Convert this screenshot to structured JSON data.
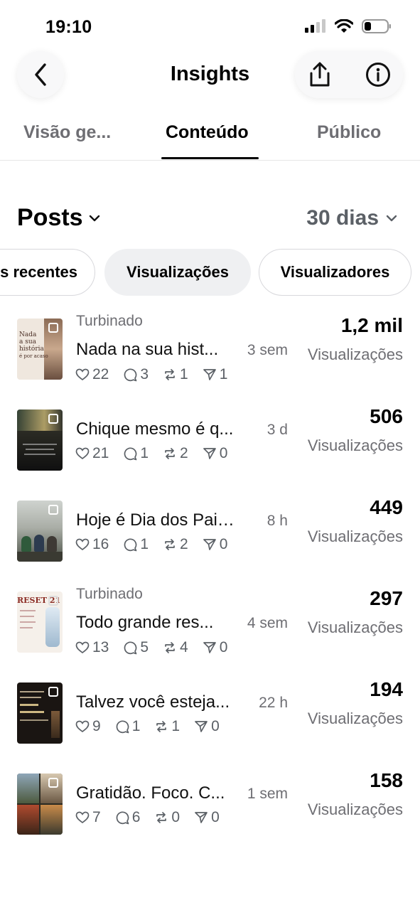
{
  "status_bar": {
    "time": "19:10"
  },
  "header": {
    "title": "Insights"
  },
  "tabs": [
    {
      "label": "Visão ge..."
    },
    {
      "label": "Conteúdo"
    },
    {
      "label": "Público"
    }
  ],
  "section": {
    "title": "Posts",
    "period": "30 dias"
  },
  "chips": [
    {
      "label": "s recentes"
    },
    {
      "label": "Visualizações"
    },
    {
      "label": "Visualizadores"
    }
  ],
  "posts": [
    {
      "promoted": "Turbinado",
      "caption": "Nada na sua hist...",
      "age": "3 sem",
      "likes": "22",
      "comments": "3",
      "reposts": "1",
      "shares": "1",
      "metric": "1,2 mil",
      "metric_label": "Visualizações",
      "thumb_text": [
        "Nada",
        "a sua",
        "história",
        "é por acaso"
      ]
    },
    {
      "promoted": "",
      "caption": "Chique mesmo é q...",
      "age": "3 d",
      "likes": "21",
      "comments": "1",
      "reposts": "2",
      "shares": "0",
      "metric": "506",
      "metric_label": "Visualizações",
      "thumb_text": []
    },
    {
      "promoted": "",
      "caption": "Hoje é Dia dos Pais,...",
      "age": "8 h",
      "likes": "16",
      "comments": "1",
      "reposts": "2",
      "shares": "0",
      "metric": "449",
      "metric_label": "Visualizações",
      "thumb_text": []
    },
    {
      "promoted": "Turbinado",
      "caption": "Todo grande res...",
      "age": "4 sem",
      "likes": "13",
      "comments": "5",
      "reposts": "4",
      "shares": "0",
      "metric": "297",
      "metric_label": "Visualizações",
      "thumb_text": [
        "RESET 21"
      ]
    },
    {
      "promoted": "",
      "caption": "Talvez você esteja...",
      "age": "22 h",
      "likes": "9",
      "comments": "1",
      "reposts": "1",
      "shares": "0",
      "metric": "194",
      "metric_label": "Visualizações",
      "thumb_text": []
    },
    {
      "promoted": "",
      "caption": "Gratidão. Foco. C...",
      "age": "1 sem",
      "likes": "7",
      "comments": "6",
      "reposts": "0",
      "shares": "0",
      "metric": "158",
      "metric_label": "Visualizações",
      "thumb_text": []
    }
  ],
  "icons": {
    "back": "chevron-left-icon",
    "share": "share-icon",
    "info": "info-icon",
    "like": "heart-icon",
    "comment": "comment-icon",
    "repost": "repost-icon",
    "send": "send-icon"
  },
  "colors": {
    "accent": "#000000",
    "muted": "#6e6e73",
    "chip_selected": "#eff0f2"
  }
}
